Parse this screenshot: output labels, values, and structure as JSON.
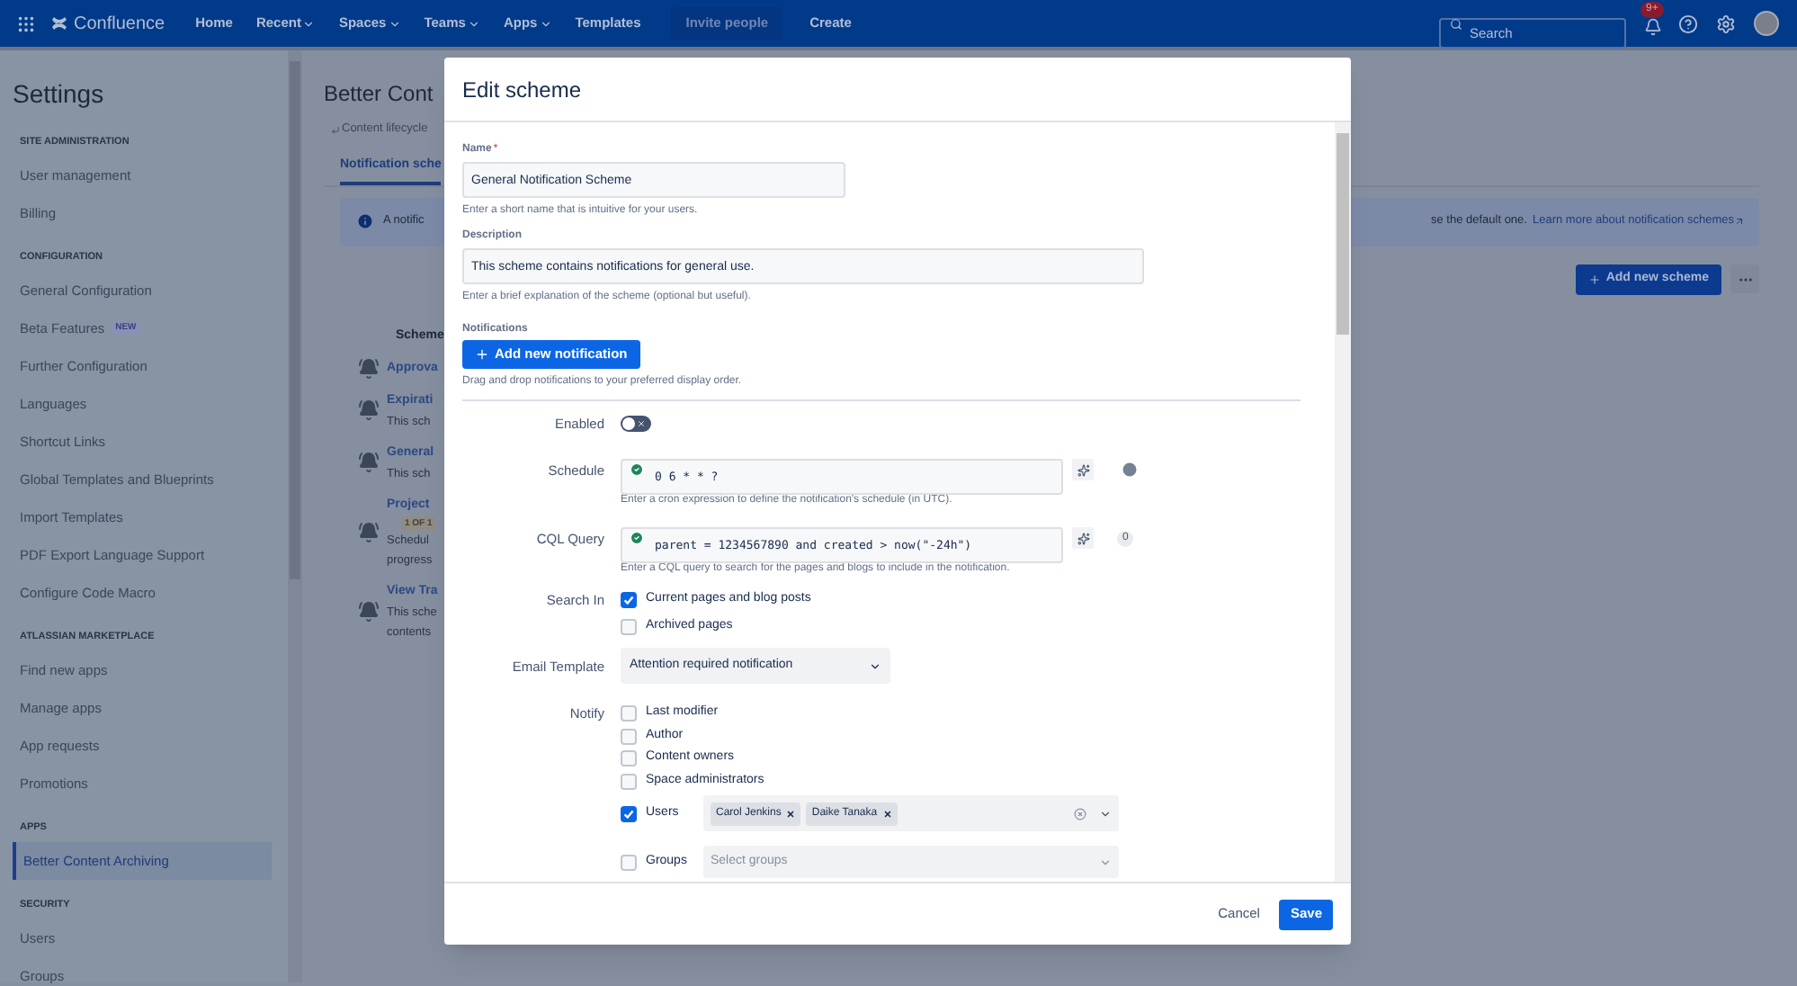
{
  "top_nav": {
    "product": "Confluence",
    "items": [
      {
        "label": "Home",
        "dropdown": false
      },
      {
        "label": "Recent",
        "dropdown": true
      },
      {
        "label": "Spaces",
        "dropdown": true
      },
      {
        "label": "Teams",
        "dropdown": true
      },
      {
        "label": "Apps",
        "dropdown": true
      },
      {
        "label": "Templates",
        "dropdown": false
      }
    ],
    "invite": "Invite people",
    "create": "Create",
    "search": {
      "placeholder": "Search"
    },
    "notifications_badge": "9+"
  },
  "sidebar": {
    "title": "Settings",
    "sections": [
      {
        "heading": "SITE ADMINISTRATION",
        "items": [
          {
            "label": "User management",
            "selected": false
          },
          {
            "label": "Billing",
            "selected": false
          }
        ]
      },
      {
        "heading": "CONFIGURATION",
        "items": [
          {
            "label": "General Configuration",
            "selected": false
          },
          {
            "label": "Beta Features",
            "badge": "NEW",
            "selected": false
          },
          {
            "label": "Further Configuration",
            "selected": false
          },
          {
            "label": "Languages",
            "selected": false
          },
          {
            "label": "Shortcut Links",
            "selected": false
          },
          {
            "label": "Global Templates and Blueprints",
            "selected": false
          },
          {
            "label": "Import Templates",
            "selected": false
          },
          {
            "label": "PDF Export Language Support",
            "selected": false
          },
          {
            "label": "Configure Code Macro",
            "selected": false
          }
        ]
      },
      {
        "heading": "ATLASSIAN MARKETPLACE",
        "items": [
          {
            "label": "Find new apps",
            "selected": false
          },
          {
            "label": "Manage apps",
            "selected": false
          },
          {
            "label": "App requests",
            "selected": false
          },
          {
            "label": "Promotions",
            "selected": false
          }
        ]
      },
      {
        "heading": "APPS",
        "items": [
          {
            "label": "Better Content Archiving",
            "selected": true
          }
        ]
      },
      {
        "heading": "SECURITY",
        "items": [
          {
            "label": "Users",
            "selected": false
          },
          {
            "label": "Groups",
            "selected": false
          }
        ]
      }
    ]
  },
  "page": {
    "title": "Better Cont",
    "breadcrumb": "Content lifecycle",
    "tab": "Notification sche",
    "info_left": "A notific",
    "info_right": "se the default one.",
    "info_link": "Learn more about notification schemes",
    "add_button": "Add new scheme",
    "list_header": "Scheme",
    "schemes": [
      {
        "title": "Approva"
      },
      {
        "title": "Expirati",
        "lines": [
          "This sch"
        ]
      },
      {
        "title": "General",
        "lines": [
          "This sch"
        ]
      },
      {
        "title": "Project",
        "lozenge": "1 OF 1",
        "lines": [
          "Schedul",
          "progress"
        ]
      },
      {
        "title": "View Tra",
        "lines": [
          "This sche",
          "contents"
        ]
      }
    ]
  },
  "modal": {
    "title": "Edit scheme",
    "name": {
      "label": "Name",
      "required_mark": "*",
      "value": "General Notification Scheme",
      "help": "Enter a short name that is intuitive for your users."
    },
    "description": {
      "label": "Description",
      "value": "This scheme contains notifications for general use.",
      "help": "Enter a brief explanation of the scheme (optional but useful)."
    },
    "notifications": {
      "label": "Notifications",
      "button": "Add new notification",
      "help": "Drag and drop notifications to your preferred display order."
    },
    "enabled": {
      "label": "Enabled",
      "on": false
    },
    "schedule": {
      "label": "Schedule",
      "value": "0 6 * * ?",
      "valid": true,
      "help": "Enter a cron expression to define the notification's schedule (in UTC)."
    },
    "cql": {
      "label": "CQL Query",
      "value": "parent = 1234567890 and created > now(\"-24h\")",
      "valid": true,
      "count": "0",
      "help": "Enter a CQL query to search for the pages and blogs to include in the notification."
    },
    "search_in": {
      "label": "Search In",
      "options": [
        {
          "label": "Current pages and blog posts",
          "checked": true
        },
        {
          "label": "Archived pages",
          "checked": false
        }
      ]
    },
    "email_template": {
      "label": "Email Template",
      "value": "Attention required notification"
    },
    "notify": {
      "label": "Notify",
      "options": [
        {
          "kind": "plain",
          "label": "Last modifier",
          "checked": false
        },
        {
          "kind": "plain",
          "label": "Author",
          "checked": false
        },
        {
          "kind": "plain",
          "label": "Content owners",
          "checked": false
        },
        {
          "kind": "plain",
          "label": "Space administrators",
          "checked": false
        },
        {
          "kind": "users",
          "label": "Users",
          "checked": true,
          "tags": [
            "Carol Jenkins",
            "Daike Tanaka"
          ]
        },
        {
          "kind": "groups",
          "label": "Groups",
          "checked": false,
          "placeholder": "Select groups"
        }
      ]
    },
    "footer": {
      "cancel": "Cancel",
      "save": "Save"
    }
  }
}
